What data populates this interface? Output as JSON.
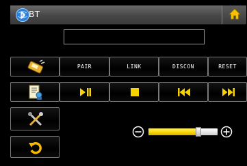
{
  "title": {
    "text": "BT",
    "icon": "bluetooth-globe-icon"
  },
  "home": {
    "icon": "home-icon"
  },
  "device_name": {
    "value": ""
  },
  "row1": {
    "icon": "pair-phone-icon",
    "pair": "PAIR",
    "link": "LINK",
    "discon": "DISCON",
    "reset": "RESET"
  },
  "row2": {
    "icon": "phonebook-icon",
    "play_pause": "play-pause-icon",
    "stop": "stop-icon",
    "prev": "previous-track-icon",
    "next": "next-track-icon"
  },
  "side": {
    "settings": "tools-icon",
    "back": "back-arrow-icon"
  },
  "volume": {
    "decrease_icon": "minus-circle-icon",
    "increase_icon": "plus-circle-icon",
    "level": 0.72
  },
  "colors": {
    "accent": "#f7d400",
    "border": "#7a7a7a",
    "background": "#000000"
  }
}
